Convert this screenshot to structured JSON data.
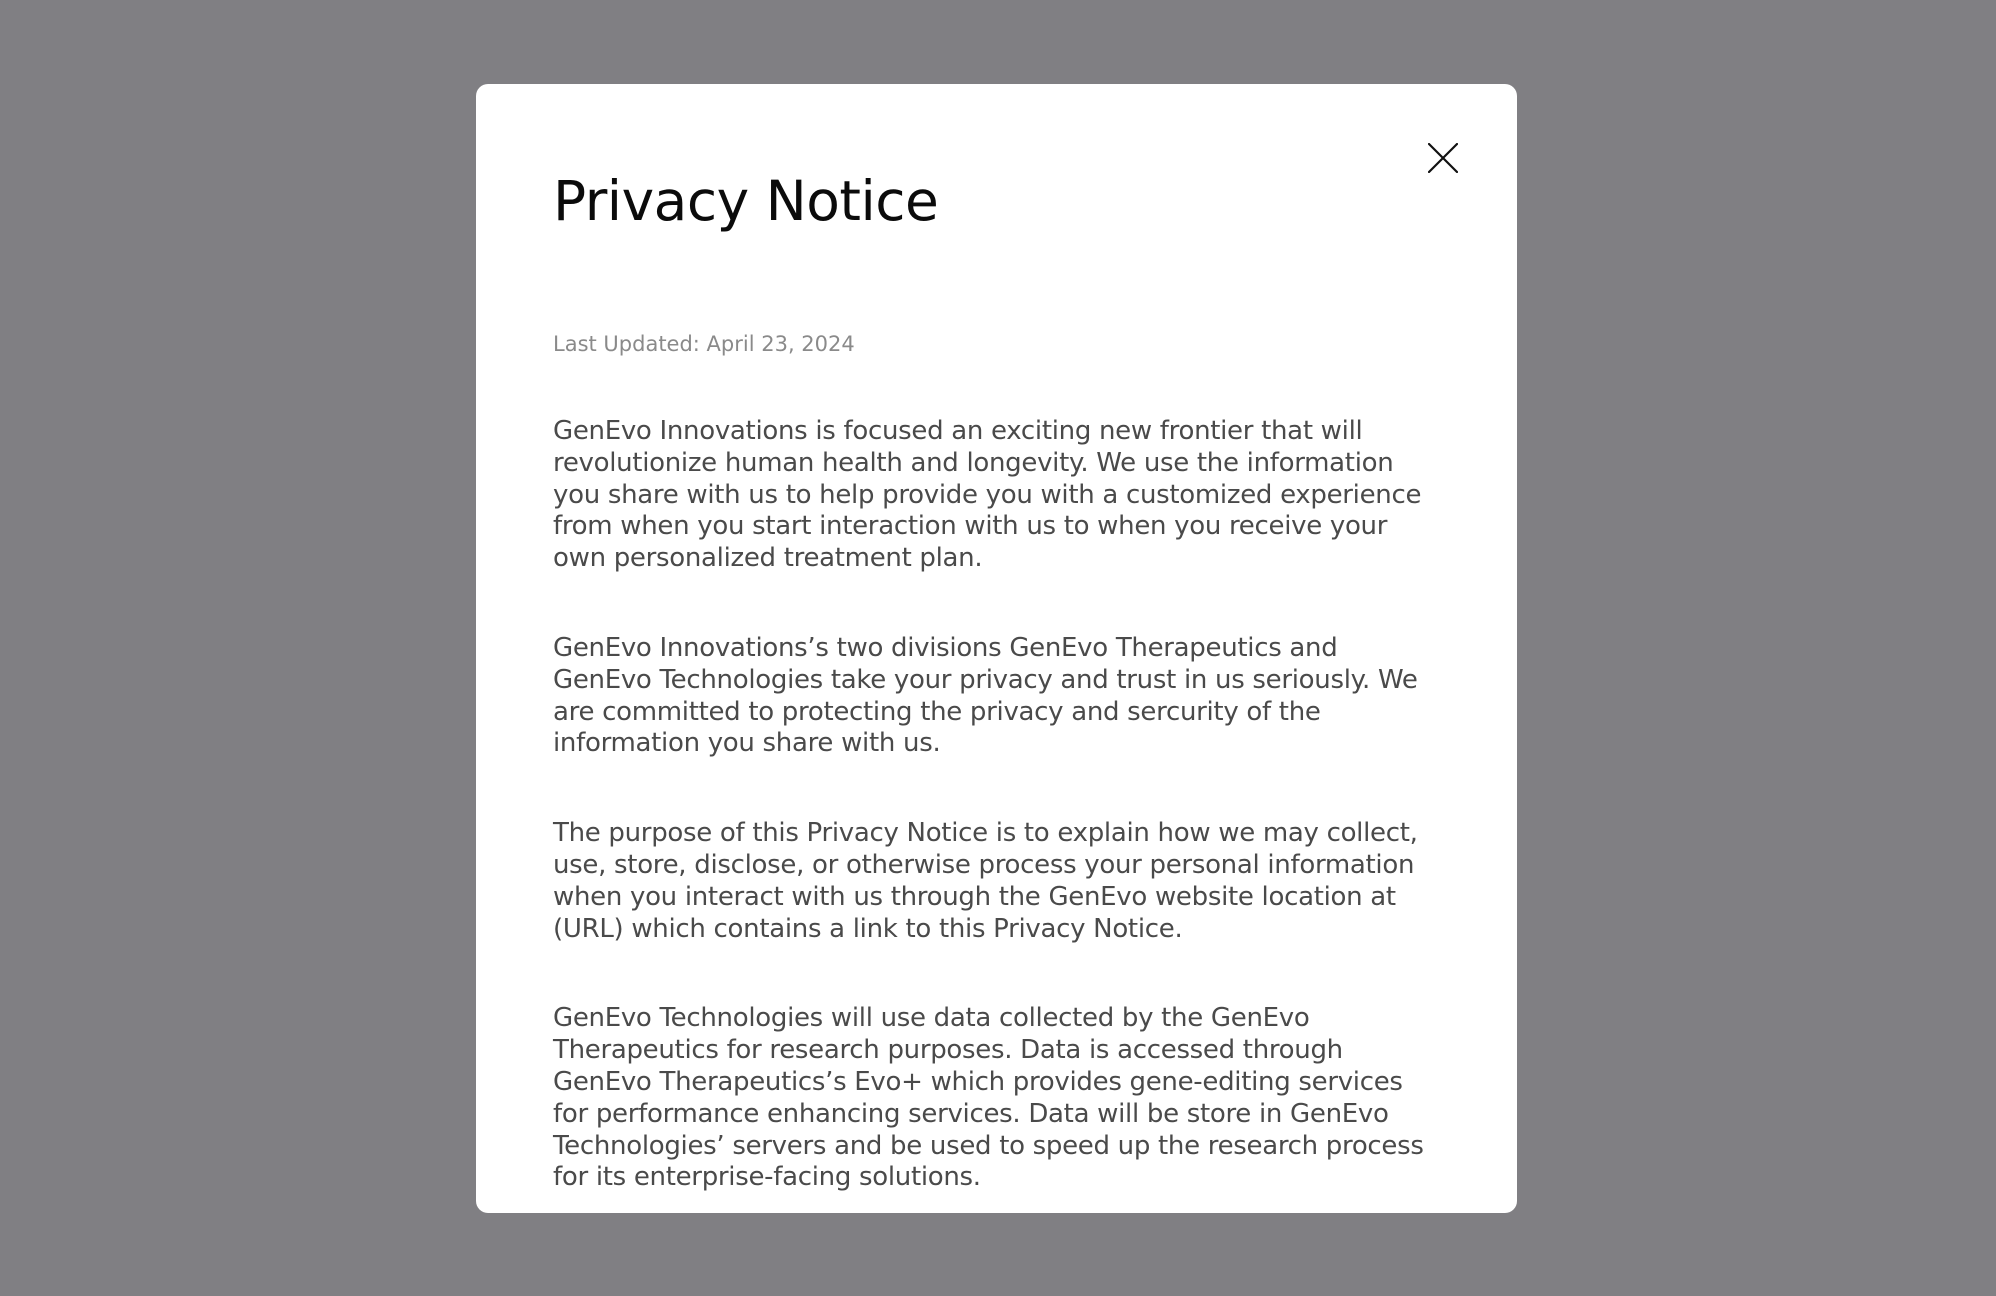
{
  "modal": {
    "title": "Privacy Notice",
    "last_updated": "Last Updated: April 23, 2024",
    "close_icon": "close-icon",
    "paragraphs": [
      "GenEvo Innovations is focused an exciting new frontier that will revolutionize human health and longevity. We use the information you share with us to help provide you with a customized experience from when you start interaction with us to when you receive your own personalized treatment plan.",
      "GenEvo Innovations’s two divisions GenEvo Therapeutics and GenEvo Technologies take your privacy and trust in us seriously. We are committed to protecting the privacy and sercurity of the information you share with us.",
      "The purpose of this Privacy Notice is to explain how we may collect, use, store, disclose, or otherwise process your personal information when you interact with us through the GenEvo website location at (URL) which contains a link to this Privacy Notice.",
      "GenEvo Technologies will use data collected by the GenEvo Therapeutics for research purposes. Data is accessed through GenEvo Therapeutics’s Evo+ which provides gene-editing services for performance enhancing services. Data will be store in GenEvo Technologies’ servers and be used to speed up the research process for its enterprise-facing solutions."
    ]
  },
  "colors": {
    "backdrop": "#807f83",
    "modal_bg": "#ffffff",
    "title": "#0b0b0b",
    "meta": "#8a8a8a",
    "body_text": "#4a4a4a"
  }
}
